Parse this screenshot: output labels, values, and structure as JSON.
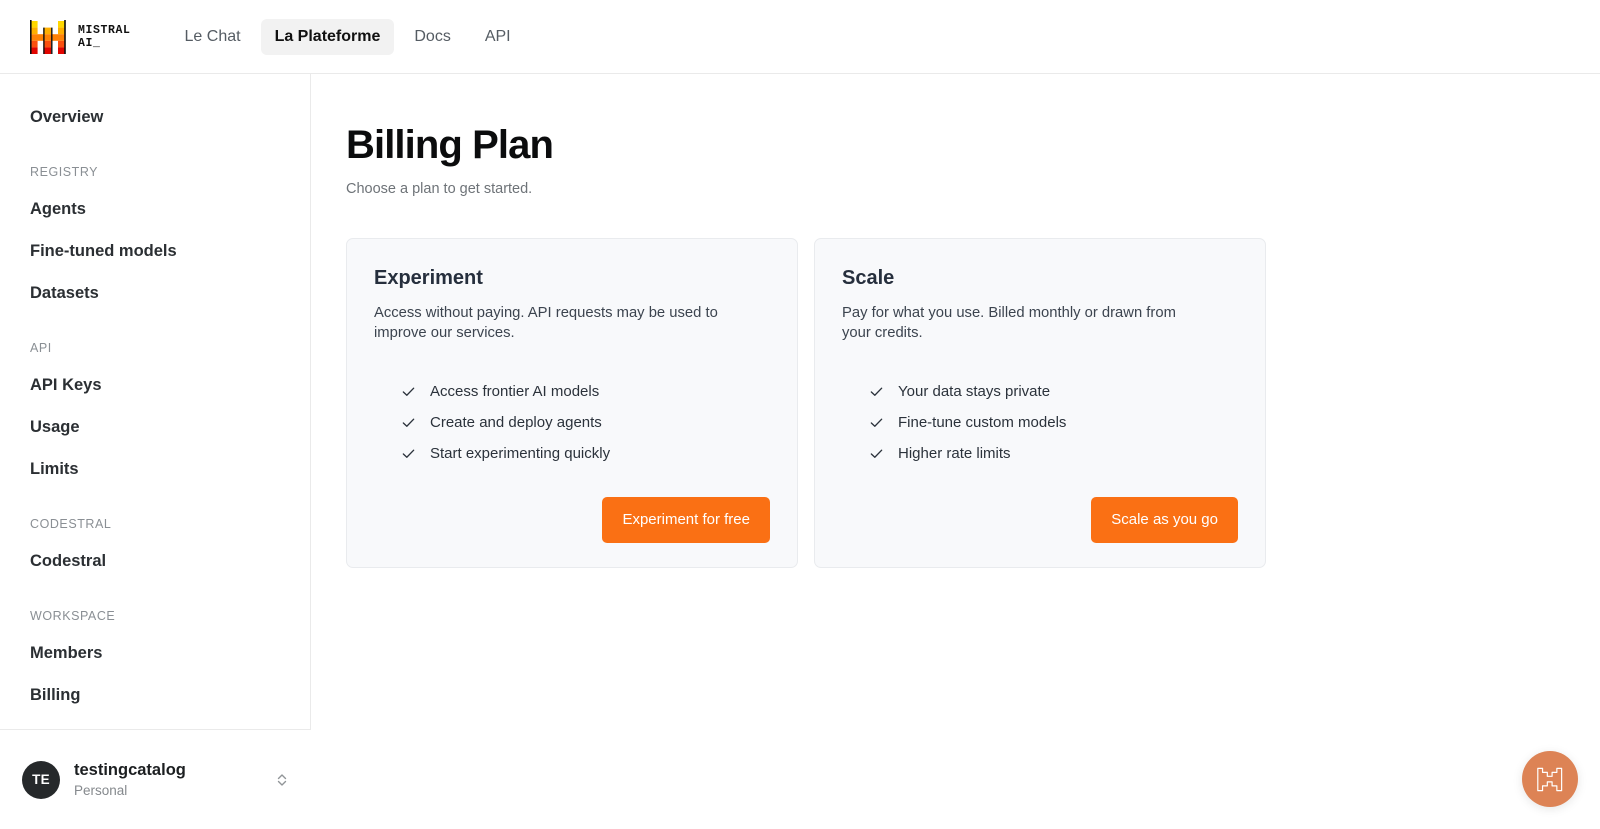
{
  "topnav": {
    "brand": {
      "logo_icon": "mistral-logo-icon",
      "wordmark_line1": "MISTRAL",
      "wordmark_line2": "AI_",
      "colors": [
        "#FFD800",
        "#FFAF00",
        "#FF8205",
        "#FA500F",
        "#E10500"
      ]
    },
    "links": [
      {
        "label": "Le Chat",
        "active": false
      },
      {
        "label": "La Plateforme",
        "active": true
      },
      {
        "label": "Docs",
        "active": false
      },
      {
        "label": "API",
        "active": false
      }
    ]
  },
  "sidebar": {
    "top_items": [
      {
        "label": "Overview"
      }
    ],
    "groups": [
      {
        "label": "REGISTRY",
        "items": [
          {
            "label": "Agents"
          },
          {
            "label": "Fine-tuned models"
          },
          {
            "label": "Datasets"
          }
        ]
      },
      {
        "label": "API",
        "items": [
          {
            "label": "API Keys"
          },
          {
            "label": "Usage"
          },
          {
            "label": "Limits"
          }
        ]
      },
      {
        "label": "CODESTRAL",
        "items": [
          {
            "label": "Codestral"
          }
        ]
      },
      {
        "label": "WORKSPACE",
        "items": [
          {
            "label": "Members"
          },
          {
            "label": "Billing"
          }
        ]
      }
    ],
    "account": {
      "avatar_initials": "TE",
      "name": "testingcatalog",
      "plan": "Personal",
      "selector_icon": "chevron-up-down-icon"
    }
  },
  "main": {
    "title": "Billing Plan",
    "subtitle": "Choose a plan to get started.",
    "accent_color": "#FA7014",
    "plans": [
      {
        "name": "Experiment",
        "description": "Access without paying. API requests may be used to improve our services.",
        "features": [
          "Access frontier AI models",
          "Create and deploy agents",
          "Start experimenting quickly"
        ],
        "cta_label": "Experiment for free"
      },
      {
        "name": "Scale",
        "description": "Pay for what you use. Billed monthly or drawn from your credits.",
        "features": [
          "Your data stays private",
          "Fine-tune custom models",
          "Higher rate limits"
        ],
        "cta_label": "Scale as you go"
      }
    ]
  },
  "fab": {
    "icon": "mistral-logo-outline-icon",
    "color": "#DD8355"
  }
}
